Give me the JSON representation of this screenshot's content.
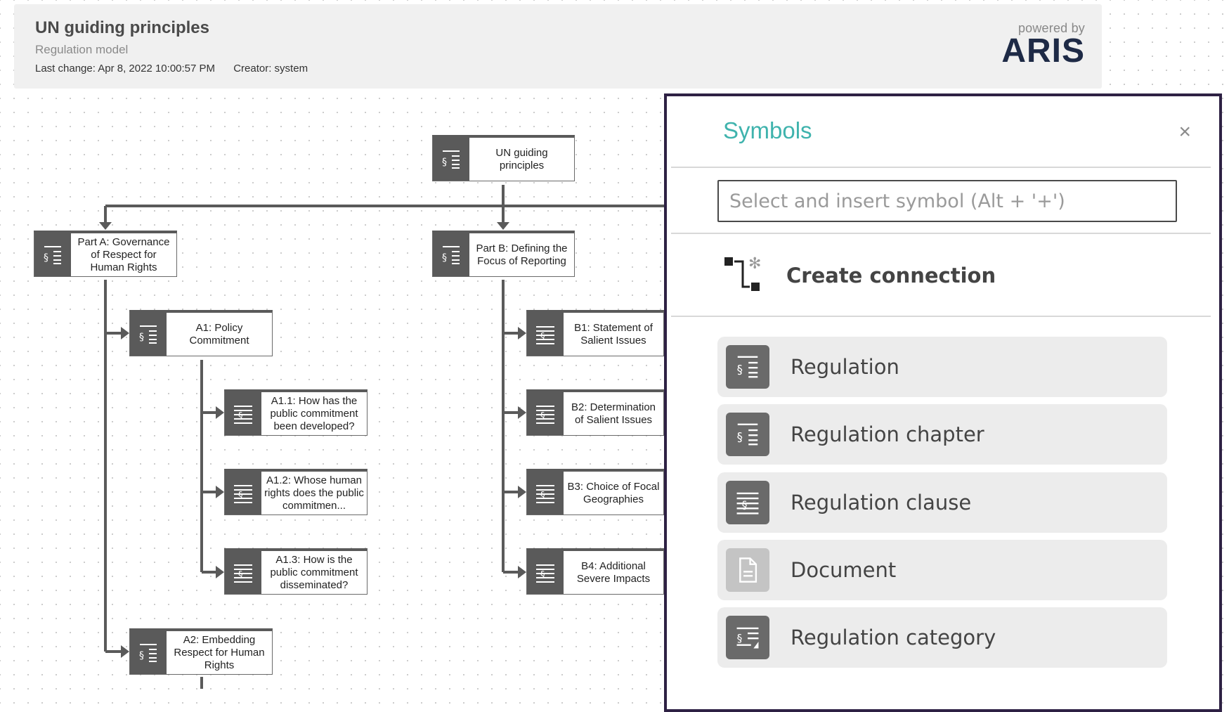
{
  "header": {
    "title": "UN guiding principles",
    "subtitle": "Regulation model",
    "last_change": "Last change: Apr 8, 2022 10:00:57 PM",
    "creator": "Creator: system",
    "powered_by": "powered by",
    "brand": "ARIS"
  },
  "diagram": {
    "root": "UN guiding principles",
    "part_a": "Part A: Governance of Respect for Human Rights",
    "part_b": "Part B: Defining the Focus of Reporting",
    "a1": "A1: Policy Commitment",
    "a1_1": "A1.1: How has the public commitment been developed?",
    "a1_2": "A1.2: Whose human rights does the public commitmen...",
    "a1_3": "A1.3: How is the public commitment disseminated?",
    "a2": "A2: Embedding Respect for Human Rights",
    "b1": "B1: Statement of Salient Issues",
    "b2": "B2: Determination of Salient Issues",
    "b3": "B3: Choice of Focal Geographies",
    "b4": "B4: Additional Severe Impacts"
  },
  "symbols_panel": {
    "title": "Symbols",
    "close": "×",
    "search_placeholder": "Select and insert symbol (Alt + '+')",
    "create_connection": "Create connection",
    "items": [
      {
        "label": "Regulation",
        "icon": "regulation-icon"
      },
      {
        "label": "Regulation chapter",
        "icon": "regulation-chapter-icon"
      },
      {
        "label": "Regulation clause",
        "icon": "regulation-clause-icon"
      },
      {
        "label": "Document",
        "icon": "document-icon"
      },
      {
        "label": "Regulation category",
        "icon": "regulation-category-icon"
      }
    ]
  }
}
